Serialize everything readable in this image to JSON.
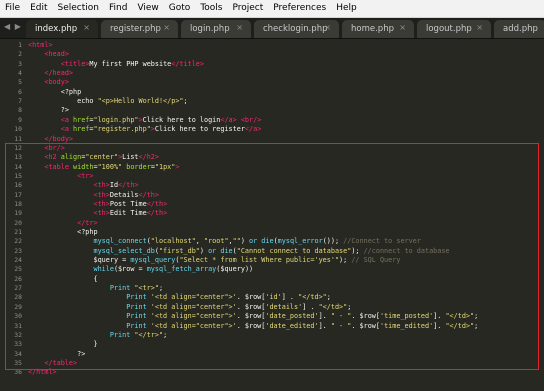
{
  "menu": [
    "File",
    "Edit",
    "Selection",
    "Find",
    "View",
    "Goto",
    "Tools",
    "Project",
    "Preferences",
    "Help"
  ],
  "tabs": [
    {
      "label": "index.php",
      "close": "×",
      "active": true
    },
    {
      "label": "register.php",
      "close": "×",
      "active": false
    },
    {
      "label": "login.php",
      "close": "×",
      "active": false
    },
    {
      "label": "checklogin.php",
      "close": "×",
      "active": false
    },
    {
      "label": "home.php",
      "close": "×",
      "active": false
    },
    {
      "label": "logout.php",
      "close": "×",
      "active": false
    },
    {
      "label": "add.php",
      "close": "",
      "active": false
    }
  ],
  "tab_nav": "◀ ▶",
  "line_numbers": [
    "1",
    "2",
    "3",
    "4",
    "5",
    "6",
    "7",
    "8",
    "9",
    "10",
    "11",
    "12",
    "13",
    "14",
    "15",
    "16",
    "17",
    "18",
    "19",
    "20",
    "21",
    "22",
    "23",
    "24",
    "25",
    "26",
    "27",
    "28",
    "29",
    "30",
    "31",
    "32",
    "33",
    "34",
    "35",
    "36"
  ],
  "code": [
    [
      [
        "tag",
        "<html>"
      ]
    ],
    [
      [
        "pun",
        "    "
      ],
      [
        "tag",
        "<head>"
      ]
    ],
    [
      [
        "pun",
        "        "
      ],
      [
        "tag",
        "<title>"
      ],
      [
        "pun",
        "My first PHP website"
      ],
      [
        "tag",
        "</title>"
      ]
    ],
    [
      [
        "pun",
        "    "
      ],
      [
        "tag",
        "</head>"
      ]
    ],
    [
      [
        "pun",
        "    "
      ],
      [
        "tag",
        "<body>"
      ]
    ],
    [
      [
        "pun",
        "        <?php"
      ]
    ],
    [
      [
        "pun",
        "            echo "
      ],
      [
        "str",
        "\"<p>Hello World!</p>\""
      ],
      [
        "pun",
        ";"
      ]
    ],
    [
      [
        "pun",
        "        ?>"
      ]
    ],
    [
      [
        "pun",
        "        "
      ],
      [
        "tag",
        "<a"
      ],
      [
        "pun",
        " "
      ],
      [
        "attr",
        "href"
      ],
      [
        "pun",
        "="
      ],
      [
        "str",
        "\"login.php\""
      ],
      [
        "tag",
        ">"
      ],
      [
        "pun",
        "Click here to login"
      ],
      [
        "tag",
        "</a>"
      ],
      [
        "pun",
        " "
      ],
      [
        "tag",
        "<br/>"
      ]
    ],
    [
      [
        "pun",
        "        "
      ],
      [
        "tag",
        "<a"
      ],
      [
        "pun",
        " "
      ],
      [
        "attr",
        "href"
      ],
      [
        "pun",
        "="
      ],
      [
        "str",
        "\"register.php\""
      ],
      [
        "tag",
        ">"
      ],
      [
        "pun",
        "Click here to register"
      ],
      [
        "tag",
        "</a>"
      ]
    ],
    [
      [
        "pun",
        "    "
      ],
      [
        "tag",
        "</body>"
      ]
    ],
    [
      [
        "pun",
        "    "
      ],
      [
        "tag",
        "<br/>"
      ]
    ],
    [
      [
        "pun",
        "    "
      ],
      [
        "tag",
        "<h2"
      ],
      [
        "pun",
        " "
      ],
      [
        "attr",
        "align"
      ],
      [
        "pun",
        "="
      ],
      [
        "str",
        "\"center\""
      ],
      [
        "tag",
        ">"
      ],
      [
        "pun",
        "List"
      ],
      [
        "tag",
        "</h2>"
      ]
    ],
    [
      [
        "pun",
        "    "
      ],
      [
        "tag",
        "<table"
      ],
      [
        "pun",
        " "
      ],
      [
        "attr",
        "width"
      ],
      [
        "pun",
        "="
      ],
      [
        "str",
        "\"100%\""
      ],
      [
        "pun",
        " "
      ],
      [
        "attr",
        "border"
      ],
      [
        "pun",
        "="
      ],
      [
        "str",
        "\"1px\""
      ],
      [
        "tag",
        ">"
      ]
    ],
    [
      [
        "pun",
        "            "
      ],
      [
        "tag",
        "<tr>"
      ]
    ],
    [
      [
        "pun",
        "                "
      ],
      [
        "tag",
        "<th>"
      ],
      [
        "pun",
        "Id"
      ],
      [
        "tag",
        "</th>"
      ]
    ],
    [
      [
        "pun",
        "                "
      ],
      [
        "tag",
        "<th>"
      ],
      [
        "pun",
        "Details"
      ],
      [
        "tag",
        "</th>"
      ]
    ],
    [
      [
        "pun",
        "                "
      ],
      [
        "tag",
        "<th>"
      ],
      [
        "pun",
        "Post Time"
      ],
      [
        "tag",
        "</th>"
      ]
    ],
    [
      [
        "pun",
        "                "
      ],
      [
        "tag",
        "<th>"
      ],
      [
        "pun",
        "Edit Time"
      ],
      [
        "tag",
        "</th>"
      ]
    ],
    [
      [
        "pun",
        "            "
      ],
      [
        "tag",
        "</tr>"
      ]
    ],
    [
      [
        "pun",
        "            <?php"
      ]
    ],
    [
      [
        "pun",
        "                "
      ],
      [
        "fn",
        "mysql_connect"
      ],
      [
        "pun",
        "("
      ],
      [
        "str",
        "\"localhost\""
      ],
      [
        "pun",
        ", "
      ],
      [
        "str",
        "\"root\""
      ],
      [
        "pun",
        ","
      ],
      [
        "str",
        "\"\""
      ],
      [
        "pun",
        ") "
      ],
      [
        "kw",
        "or"
      ],
      [
        "pun",
        " "
      ],
      [
        "fn",
        "die"
      ],
      [
        "pun",
        "("
      ],
      [
        "fn",
        "mysql_error"
      ],
      [
        "pun",
        "()); "
      ],
      [
        "com",
        "//Connect to server"
      ]
    ],
    [
      [
        "pun",
        "                "
      ],
      [
        "fn",
        "mysql_select_db"
      ],
      [
        "pun",
        "("
      ],
      [
        "str",
        "\"first_db\""
      ],
      [
        "pun",
        ") "
      ],
      [
        "kw",
        "or"
      ],
      [
        "pun",
        " "
      ],
      [
        "fn",
        "die"
      ],
      [
        "pun",
        "("
      ],
      [
        "str",
        "\"Cannot connect to database\""
      ],
      [
        "pun",
        "); "
      ],
      [
        "com",
        "//connect to database"
      ]
    ],
    [
      [
        "pun",
        "                "
      ],
      [
        "var",
        "$query"
      ],
      [
        "pun",
        " = "
      ],
      [
        "fn",
        "mysql_query"
      ],
      [
        "pun",
        "("
      ],
      [
        "str",
        "\"Select * from list Where public='yes'\""
      ],
      [
        "pun",
        "); "
      ],
      [
        "com",
        "// SQL Query"
      ]
    ],
    [
      [
        "pun",
        "                "
      ],
      [
        "kw",
        "while"
      ],
      [
        "pun",
        "("
      ],
      [
        "var",
        "$row"
      ],
      [
        "pun",
        " = "
      ],
      [
        "fn",
        "mysql_fetch_array"
      ],
      [
        "pun",
        "("
      ],
      [
        "var",
        "$query"
      ],
      [
        "pun",
        "))"
      ]
    ],
    [
      [
        "pun",
        "                {"
      ]
    ],
    [
      [
        "pun",
        "                    "
      ],
      [
        "kw",
        "Print"
      ],
      [
        "pun",
        " "
      ],
      [
        "str",
        "\"<tr>\""
      ],
      [
        "pun",
        ";"
      ]
    ],
    [
      [
        "pun",
        "                        "
      ],
      [
        "kw",
        "Print"
      ],
      [
        "pun",
        " "
      ],
      [
        "str",
        "'<td align=\"center\">'"
      ],
      [
        "pun",
        ". "
      ],
      [
        "var",
        "$row"
      ],
      [
        "pun",
        "["
      ],
      [
        "str",
        "'id'"
      ],
      [
        "pun",
        "] . "
      ],
      [
        "str",
        "\"</td>\""
      ],
      [
        "pun",
        ";"
      ]
    ],
    [
      [
        "pun",
        "                        "
      ],
      [
        "kw",
        "Print"
      ],
      [
        "pun",
        " "
      ],
      [
        "str",
        "'<td align=\"center\">'"
      ],
      [
        "pun",
        ". "
      ],
      [
        "var",
        "$row"
      ],
      [
        "pun",
        "["
      ],
      [
        "str",
        "'details'"
      ],
      [
        "pun",
        "] . "
      ],
      [
        "str",
        "\"</td>\""
      ],
      [
        "pun",
        ";"
      ]
    ],
    [
      [
        "pun",
        "                        "
      ],
      [
        "kw",
        "Print"
      ],
      [
        "pun",
        " "
      ],
      [
        "str",
        "'<td align=\"center\">'"
      ],
      [
        "pun",
        ". "
      ],
      [
        "var",
        "$row"
      ],
      [
        "pun",
        "["
      ],
      [
        "str",
        "'date_posted'"
      ],
      [
        "pun",
        "]. "
      ],
      [
        "str",
        "\" - \""
      ],
      [
        "pun",
        ". "
      ],
      [
        "var",
        "$row"
      ],
      [
        "pun",
        "["
      ],
      [
        "str",
        "'time_posted'"
      ],
      [
        "pun",
        "]. "
      ],
      [
        "str",
        "\"</td>\""
      ],
      [
        "pun",
        ";"
      ]
    ],
    [
      [
        "pun",
        "                        "
      ],
      [
        "kw",
        "Print"
      ],
      [
        "pun",
        " "
      ],
      [
        "str",
        "'<td align=\"center\">'"
      ],
      [
        "pun",
        ". "
      ],
      [
        "var",
        "$row"
      ],
      [
        "pun",
        "["
      ],
      [
        "str",
        "'date_edited'"
      ],
      [
        "pun",
        "]. "
      ],
      [
        "str",
        "\" - \""
      ],
      [
        "pun",
        ". "
      ],
      [
        "var",
        "$row"
      ],
      [
        "pun",
        "["
      ],
      [
        "str",
        "'time_edited'"
      ],
      [
        "pun",
        "]. "
      ],
      [
        "str",
        "\"</td>\""
      ],
      [
        "pun",
        ";"
      ]
    ],
    [
      [
        "pun",
        "                    "
      ],
      [
        "kw",
        "Print"
      ],
      [
        "pun",
        " "
      ],
      [
        "str",
        "\"</tr>\""
      ],
      [
        "pun",
        ";"
      ]
    ],
    [
      [
        "pun",
        "                }"
      ]
    ],
    [
      [
        "pun",
        "            ?>"
      ]
    ],
    [
      [
        "pun",
        "    "
      ],
      [
        "tag",
        "</table>"
      ]
    ],
    [
      [
        "tag",
        "</html>"
      ]
    ]
  ]
}
